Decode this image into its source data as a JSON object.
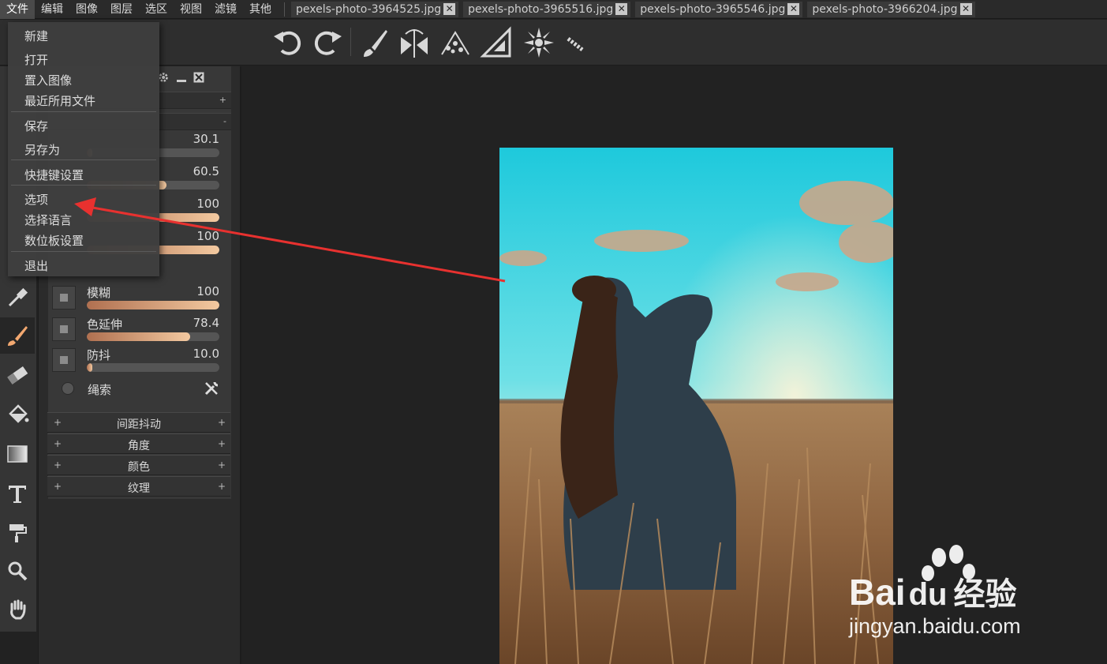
{
  "menubar": {
    "items": [
      "文件",
      "编辑",
      "图像",
      "图层",
      "选区",
      "视图",
      "滤镜",
      "其他"
    ],
    "tabs": [
      "pexels-photo-3964525.jpg",
      "pexels-photo-3965516.jpg",
      "pexels-photo-3965546.jpg",
      "pexels-photo-3966204.jpg"
    ],
    "tab_close": "✕"
  },
  "toolbar": {
    "icons": [
      "undo-icon",
      "redo-icon",
      "brush-icon",
      "symmetry-icon",
      "scatter-icon",
      "ruler-icon",
      "mandala-icon",
      "pencil-line-icon"
    ]
  },
  "tools": [
    "eyedropper-icon",
    "brush-icon",
    "eraser-icon",
    "fill-icon",
    "gradient-icon",
    "text-icon",
    "paint-roller-icon",
    "zoom-icon",
    "hand-icon"
  ],
  "panel": {
    "bar1_symbol": "+",
    "bar2_symbol": "-",
    "sliders": [
      {
        "label": "",
        "value": "30.1",
        "fill": 0.0
      },
      {
        "label": "",
        "value": "60.5",
        "fill": 0.6
      },
      {
        "label": "",
        "value": "100",
        "fill": 1.0
      },
      {
        "label": "",
        "value": "100",
        "fill": 1.0
      },
      {
        "label": "模糊",
        "value": "100",
        "fill": 1.0
      },
      {
        "label": "色延伸",
        "value": "78.4",
        "fill": 0.78
      },
      {
        "label": "防抖",
        "value": "10.0",
        "fill": 0.03
      }
    ],
    "lasso_label": "绳索",
    "sections": [
      "间距抖动",
      "角度",
      "颜色",
      "纹理"
    ],
    "plus": "+"
  },
  "dropdown": {
    "items": [
      "新建",
      "打开",
      "置入图像",
      "最近所用文件",
      "保存",
      "另存为",
      "快捷键设置",
      "选项",
      "选择语言",
      "数位板设置",
      "退出"
    ]
  },
  "watermark": {
    "brand": "Bai",
    "brand2": "du",
    "cn": "经验",
    "url": "jingyan.baidu.com"
  },
  "colors": {
    "annotation_arrow": "#e8312f",
    "slider_fill": "#f3c9a0"
  }
}
